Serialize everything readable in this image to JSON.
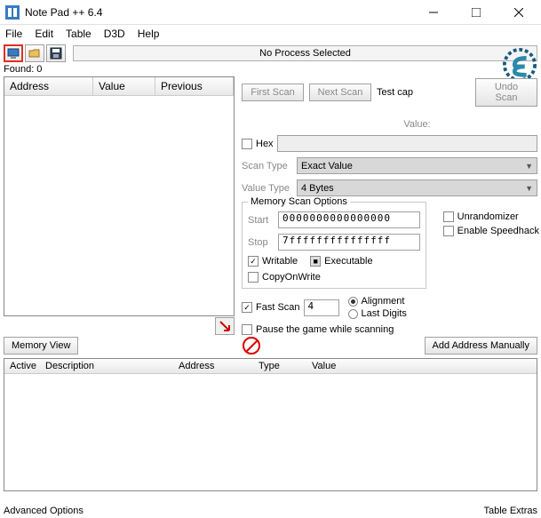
{
  "window": {
    "title": "Note Pad ++ 6.4"
  },
  "menu": {
    "file": "File",
    "edit": "Edit",
    "table": "Table",
    "d3d": "D3D",
    "help": "Help"
  },
  "toolbar": {
    "no_process": "No Process Selected"
  },
  "found": {
    "label": "Found: 0"
  },
  "results": {
    "col_address": "Address",
    "col_value": "Value",
    "col_previous": "Previous"
  },
  "scan": {
    "first": "First Scan",
    "next": "Next Scan",
    "testcap": "Test cap",
    "undo": "Undo Scan",
    "value_label": "Value:",
    "hex": "Hex",
    "scan_type_label": "Scan Type",
    "scan_type": "Exact Value",
    "value_type_label": "Value Type",
    "value_type": "4 Bytes"
  },
  "memopts": {
    "legend": "Memory Scan Options",
    "start_label": "Start",
    "start": "0000000000000000",
    "stop_label": "Stop",
    "stop": "7fffffffffffffff",
    "writable": "Writable",
    "executable": "Executable",
    "cow": "CopyOnWrite",
    "fastscan": "Fast Scan",
    "fastscan_val": "4",
    "alignment": "Alignment",
    "lastdigits": "Last Digits",
    "pause": "Pause the game while scanning"
  },
  "side": {
    "unrandomizer": "Unrandomizer",
    "speedhack": "Enable Speedhack"
  },
  "logo": {
    "label": "Settings"
  },
  "mid": {
    "memory_view": "Memory View",
    "add_manual": "Add Address Manually"
  },
  "bottom": {
    "active": "Active",
    "description": "Description",
    "address": "Address",
    "type": "Type",
    "value": "Value"
  },
  "footer": {
    "adv": "Advanced Options",
    "extras": "Table Extras"
  }
}
